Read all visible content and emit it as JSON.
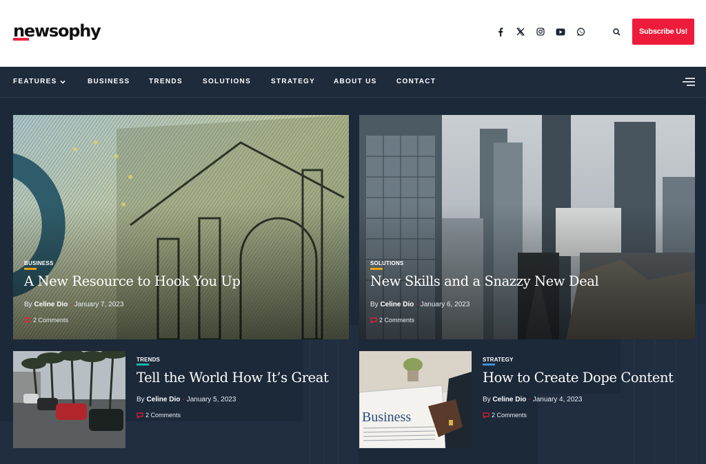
{
  "brand": {
    "logo_text": "newsophy",
    "accent": "#ee1c3b"
  },
  "header": {
    "social_icons": [
      "facebook-icon",
      "x-twitter-icon",
      "instagram-icon",
      "youtube-icon",
      "whatsapp-icon"
    ],
    "subscribe_label": "Subscribe Us!"
  },
  "nav": {
    "items": [
      {
        "label": "FEATURES"
      },
      {
        "label": "BUSINESS"
      },
      {
        "label": "TRENDS"
      },
      {
        "label": "SOLUTIONS"
      },
      {
        "label": "STRATEGY"
      },
      {
        "label": "ABOUT US"
      },
      {
        "label": "CONTACT"
      }
    ]
  },
  "posts": [
    {
      "category": "BUSINESS",
      "category_color": "#e8a317",
      "title": "A New Resource to Hook You Up",
      "by": "By",
      "author": "Celine Dio",
      "sep": "-",
      "date": "January 7, 2023",
      "comments": "2 Comments"
    },
    {
      "category": "SOLUTIONS",
      "category_color": "#e8a317",
      "title": "New Skills and a Snazzy New Deal",
      "by": "By",
      "author": "Celine Dio",
      "sep": "-",
      "date": "January 6, 2023",
      "comments": "2 Comments"
    },
    {
      "category": "TRENDS",
      "category_color": "#14b8b1",
      "title": "Tell the World How It’s Great",
      "by": "By",
      "author": "Celine Dio",
      "sep": "-",
      "date": "January 5, 2023",
      "comments": "2 Comments"
    },
    {
      "category": "STRATEGY",
      "category_color": "#3b8fd6",
      "title": "How to Create Dope Content",
      "by": "By",
      "author": "Celine Dio",
      "sep": "-",
      "date": "January 4, 2023",
      "comments": "2 Comments"
    }
  ],
  "images": {
    "newspaper_headline": "Business"
  }
}
